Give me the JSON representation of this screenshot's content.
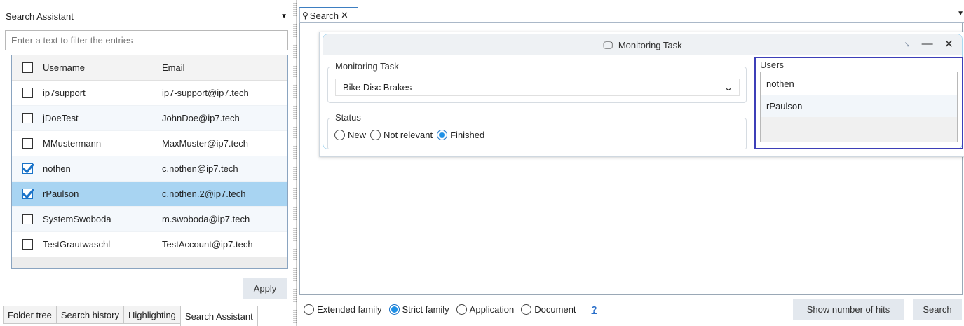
{
  "left_panel": {
    "title": "Search Assistant",
    "filter_placeholder": "Enter a text to filter the entries",
    "columns": {
      "username": "Username",
      "email": "Email"
    },
    "rows": [
      {
        "username": "ip7support",
        "email": "ip7-support@ip7.tech",
        "checked": false,
        "selected": false
      },
      {
        "username": "jDoeTest",
        "email": "JohnDoe@ip7.tech",
        "checked": false,
        "selected": false
      },
      {
        "username": "MMustermann",
        "email": "MaxMuster@ip7.tech",
        "checked": false,
        "selected": false
      },
      {
        "username": "nothen",
        "email": "c.nothen@ip7.tech",
        "checked": true,
        "selected": false
      },
      {
        "username": "rPaulson",
        "email": "c.nothen.2@ip7.tech",
        "checked": true,
        "selected": true
      },
      {
        "username": "SystemSwoboda",
        "email": "m.swoboda@ip7.tech",
        "checked": false,
        "selected": false
      },
      {
        "username": "TestGrautwaschl",
        "email": "TestAccount@ip7.tech",
        "checked": false,
        "selected": false
      }
    ],
    "apply_label": "Apply",
    "tabs": [
      "Folder tree",
      "Search history",
      "Highlighting",
      "Search Assistant"
    ],
    "active_tab": 3
  },
  "search_tab": {
    "label": "Search"
  },
  "monitoring": {
    "title": "Monitoring Task",
    "task_legend": "Monitoring Task",
    "task_value": "Bike Disc Brakes",
    "status_legend": "Status",
    "status_options": [
      "New",
      "Not relevant",
      "Finished"
    ],
    "status_selected": "Finished",
    "users_label": "Users",
    "users": [
      "nothen",
      "rPaulson"
    ]
  },
  "bottom_bar": {
    "scope_options": [
      "Extended family",
      "Strict family",
      "Application",
      "Document"
    ],
    "scope_selected": "Strict family",
    "help": "?",
    "hits_label": "Show number of hits",
    "search_label": "Search"
  },
  "colors": {
    "accent": "#1e90e6",
    "selection": "#a8d4f2",
    "highlight_border": "#3d3fb8"
  }
}
